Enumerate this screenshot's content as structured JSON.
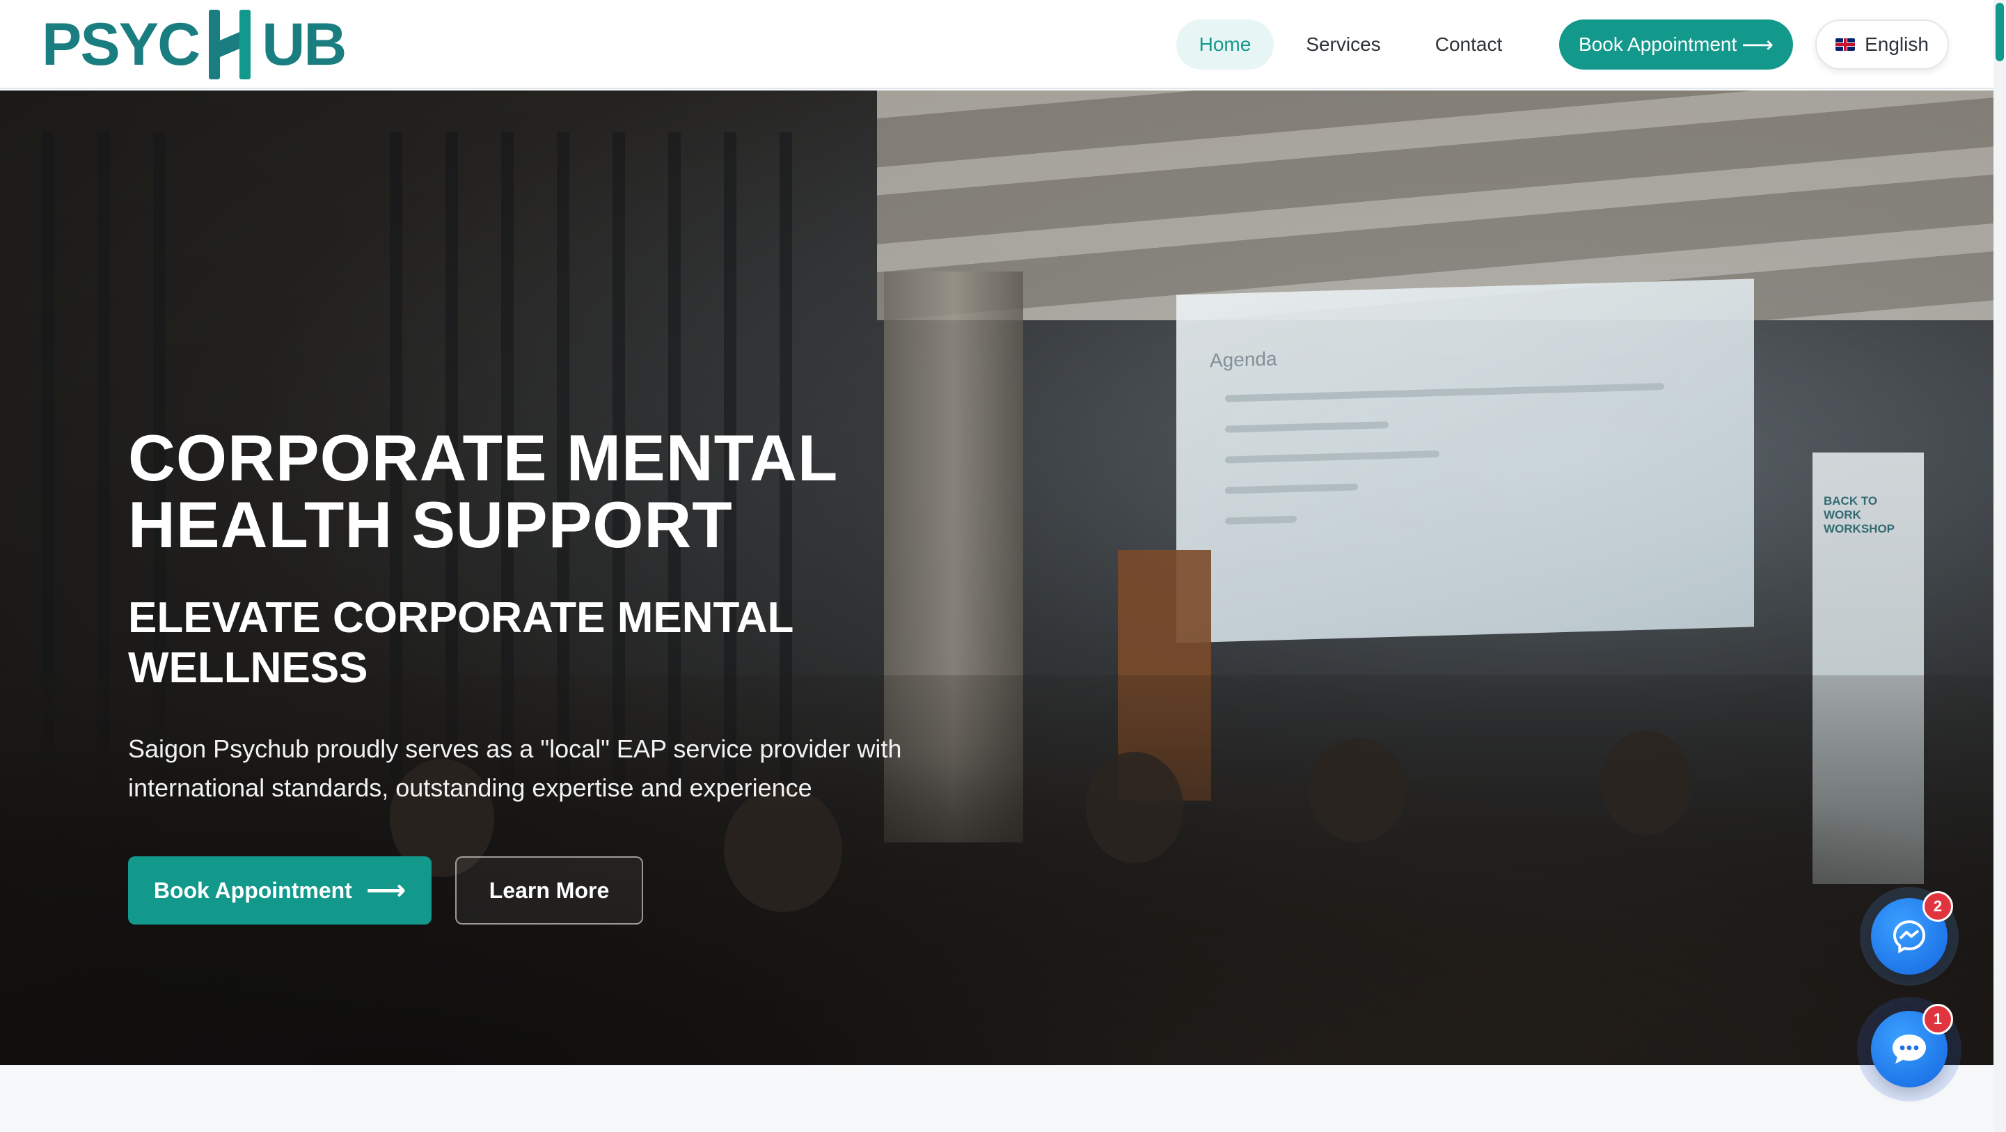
{
  "brand": {
    "name_left": "PSYC",
    "name_right": "UB",
    "accent": "#13988c"
  },
  "nav": {
    "items": [
      {
        "label": "Home"
      },
      {
        "label": "Services"
      },
      {
        "label": "Contact"
      }
    ],
    "book_label": "Book Appointment",
    "language_label": "English"
  },
  "hero": {
    "title": "CORPORATE MENTAL HEALTH SUPPORT",
    "subtitle": "ELEVATE CORPORATE MENTAL WELLNESS",
    "description": "Saigon Psychub proudly serves as a \"local\" EAP service provider with international standards, outstanding expertise and experience",
    "primary_cta": "Book Appointment",
    "secondary_cta": "Learn More",
    "image": {
      "screen_heading": "Agenda",
      "banner_text": "BACK TO WORK WORKSHOP"
    }
  },
  "widgets": {
    "messenger_badge": "2",
    "chat_badge": "1"
  },
  "icons": [
    "arrow-right-icon",
    "uk-flag-icon",
    "messenger-icon",
    "chat-bubble-icon"
  ]
}
